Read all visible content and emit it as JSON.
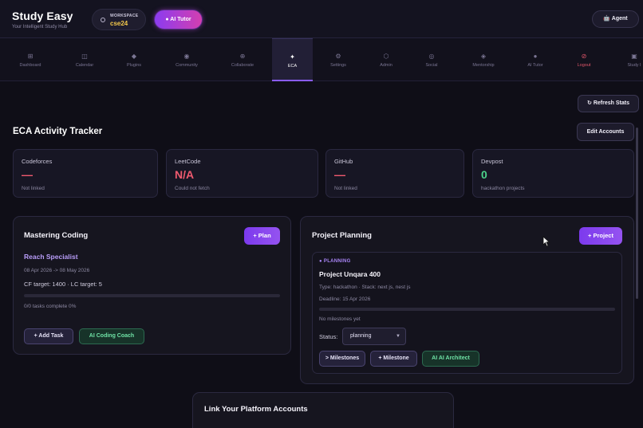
{
  "header": {
    "brand_title": "Study Easy",
    "brand_subtitle": "Your Intelligent Study Hub",
    "workspace_label": "WORKSPACE",
    "workspace_value": "cse24",
    "ai_tutor_label": "● AI Tutor",
    "agent_label": "🤖 Agent"
  },
  "nav": {
    "items": [
      {
        "label": "Dashboard",
        "icon": "⊞"
      },
      {
        "label": "Calendar",
        "icon": "◫"
      },
      {
        "label": "Plugins",
        "icon": "◆"
      },
      {
        "label": "Community",
        "icon": "◉"
      },
      {
        "label": "Collaborate",
        "icon": "⊕"
      },
      {
        "label": "ECA",
        "icon": "✦"
      },
      {
        "label": "Settings",
        "icon": "⚙"
      },
      {
        "label": "Admin",
        "icon": "⬡"
      },
      {
        "label": "Social",
        "icon": "◎"
      },
      {
        "label": "Mentorship",
        "icon": "◈"
      },
      {
        "label": "AI Tutor",
        "icon": "●"
      },
      {
        "label": "Logout",
        "icon": "⊘"
      },
      {
        "label": "Study I",
        "icon": "▣"
      }
    ],
    "active": "ECA"
  },
  "toolbar": {
    "refresh_label": "↻ Refresh Stats",
    "edit_label": "Edit Accounts"
  },
  "eca": {
    "title": "ECA Activity Tracker",
    "stats": [
      {
        "name": "Codeforces",
        "value": "—",
        "sub": "Not linked",
        "color": "#ef5a6f"
      },
      {
        "name": "LeetCode",
        "value": "N/A",
        "sub": "Could not fetch",
        "color": "#ef5a6f"
      },
      {
        "name": "GitHub",
        "value": "—",
        "sub": "Not linked",
        "color": "#ef5a6f"
      },
      {
        "name": "Devpost",
        "value": "0",
        "sub": "hackathon projects",
        "color": "#4bd38a"
      }
    ]
  },
  "coding": {
    "title": "Mastering Coding",
    "plan_button": "+ Plan",
    "goal": "Reach Specialist",
    "dates": "08 Apr 2026 -> 08 May 2026",
    "targets": "CF target: 1400  ·  LC target: 5",
    "progress_text": "0/0 tasks complete 0%",
    "progress_percent": 0,
    "add_task_button": "+ Add Task",
    "coach_button": "AI Coding Coach"
  },
  "projects": {
    "title": "Project Planning",
    "add_button": "+ Project",
    "card": {
      "badge": "● PLANNING",
      "name": "Project Unqara 400",
      "meta": "Type: hackathon  ·  Stack: next js, nest js",
      "deadline": "Deadline: 15 Apr 2026",
      "milestones_text": "No milestones yet",
      "progress_percent": 0,
      "status_label": "Status:",
      "status_value": "planning",
      "milestones_button": "> Milestones",
      "add_milestone_button": "+ Milestone",
      "architect_button": "AI AI Architect"
    }
  },
  "link_accounts": {
    "title": "Link Your Platform Accounts"
  }
}
